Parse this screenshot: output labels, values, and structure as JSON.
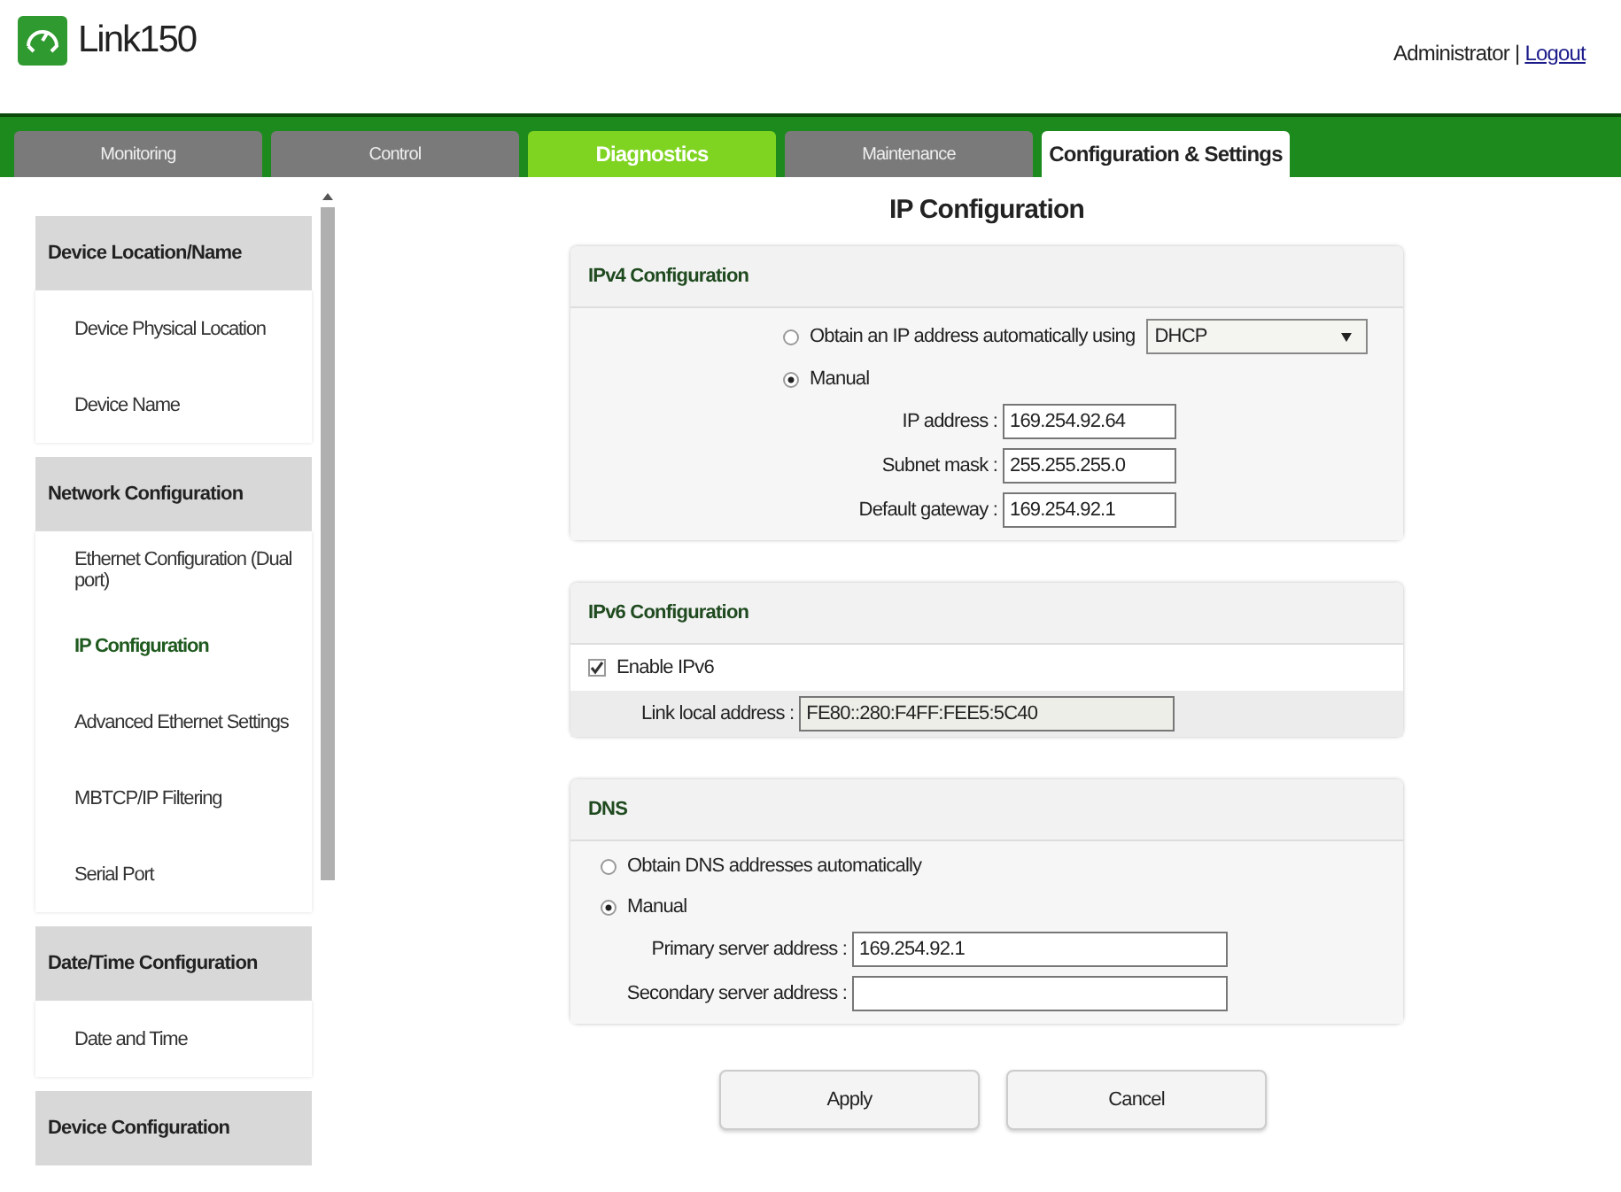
{
  "header": {
    "product": "Link150",
    "user": "Administrator",
    "separator": "|",
    "logout": "Logout"
  },
  "tabs": [
    {
      "label": "Monitoring",
      "selected": false,
      "highlighted": false
    },
    {
      "label": "Control",
      "selected": false,
      "highlighted": false
    },
    {
      "label": "Diagnostics",
      "selected": false,
      "highlighted": true
    },
    {
      "label": "Maintenance",
      "selected": false,
      "highlighted": false
    },
    {
      "label": "Configuration & Settings",
      "selected": true,
      "highlighted": false
    }
  ],
  "sidebar": {
    "groups": [
      {
        "title": "Device Location/Name",
        "items": [
          {
            "label": "Device Physical Location",
            "selected": false
          },
          {
            "label": "Device Name",
            "selected": false
          }
        ]
      },
      {
        "title": "Network Configuration",
        "items": [
          {
            "label": "Ethernet Configuration (Dual port)",
            "selected": false
          },
          {
            "label": "IP Configuration",
            "selected": true
          },
          {
            "label": "Advanced Ethernet Settings",
            "selected": false
          },
          {
            "label": "MBTCP/IP Filtering",
            "selected": false
          },
          {
            "label": "Serial Port",
            "selected": false
          }
        ]
      },
      {
        "title": "Date/Time Configuration",
        "items": [
          {
            "label": "Date and Time",
            "selected": false
          }
        ]
      },
      {
        "title": "Device Configuration"
      }
    ]
  },
  "page_title": "IP Configuration",
  "ipv4": {
    "title": "IPv4 Configuration",
    "options": [
      {
        "label": "Obtain an IP address automatically using",
        "selected": false,
        "select": "DHCP"
      },
      {
        "label": "Manual",
        "selected": true
      }
    ],
    "fields": [
      {
        "label": "IP address :",
        "value": "169.254.92.64"
      },
      {
        "label": "Subnet mask :",
        "value": "255.255.255.0"
      },
      {
        "label": "Default gateway :",
        "value": "169.254.92.1"
      }
    ]
  },
  "ipv6": {
    "title": "IPv6 Configuration",
    "enable": {
      "label": "Enable IPv6",
      "checked": true
    },
    "link_local": {
      "label": "Link local address :",
      "value": "FE80::280:F4FF:FEE5:5C40",
      "disabled": true
    }
  },
  "dns": {
    "title": "DNS",
    "options": [
      {
        "label": "Obtain DNS addresses automatically",
        "selected": false
      },
      {
        "label": "Manual",
        "selected": true
      }
    ],
    "fields": [
      {
        "label": "Primary server address :",
        "value": "169.254.92.1"
      },
      {
        "label": "Secondary server address :"
      }
    ]
  },
  "buttons": [
    "Apply",
    "Cancel"
  ]
}
